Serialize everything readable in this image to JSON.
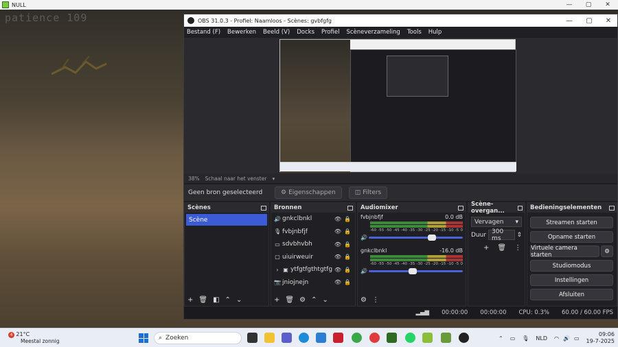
{
  "bg_window": {
    "title": "NULL",
    "patience": "patience 109",
    "controls": {
      "min": "—",
      "max": "▢",
      "close": "✕"
    }
  },
  "obs": {
    "title": "OBS 31.0.3 - Profiel: Naamloos - Scènes: gvbfgfg",
    "controls": {
      "min": "—",
      "max": "▢",
      "close": "✕"
    },
    "menu": [
      "Bestand (F)",
      "Bewerken",
      "Beeld (V)",
      "Docks",
      "Profiel",
      "Scèneverzameling",
      "Tools",
      "Hulp"
    ],
    "zoom": {
      "percent": "38%",
      "label": "Schaal naar het venster"
    },
    "source_bar": {
      "none_selected": "Geen bron geselecteerd",
      "properties": "Eigenschappen",
      "filters": "Filters"
    },
    "scenes": {
      "title": "Scènes",
      "items": [
        "Scène"
      ]
    },
    "sources": {
      "title": "Bronnen",
      "items": [
        {
          "name": "gnkclbnkl",
          "icon": "speaker-icon"
        },
        {
          "name": "fvbjnbfjf",
          "icon": "mic-icon"
        },
        {
          "name": "sdvbhvbh",
          "icon": "monitor-icon"
        },
        {
          "name": "uiuirweuir",
          "icon": "window-icon"
        },
        {
          "name": "ytfgtfgthtgtfg",
          "icon": "folder-icon"
        },
        {
          "name": "jniojnejn",
          "icon": "camera-icon"
        }
      ]
    },
    "mixer": {
      "title": "Audiomixer",
      "channels": [
        {
          "name": "fvbjnbfjf",
          "db": "0.0 dB",
          "level": 0.67
        },
        {
          "name": "gnkclbnkl",
          "db": "-16.0 dB",
          "level": 0.47
        }
      ],
      "ticks": [
        "-60",
        "-55",
        "-50",
        "-45",
        "-40",
        "-35",
        "-30",
        "-25",
        "-20",
        "-15",
        "-10",
        "-5",
        "0"
      ]
    },
    "transitions": {
      "title": "Scène-overgan...",
      "type": "Vervagen",
      "duration_label": "Duur",
      "duration": "300 ms"
    },
    "controls_dock": {
      "title": "Bedieningselementen",
      "buttons": [
        "Streamen starten",
        "Opname starten",
        "Virtuele camera starten",
        "Studiomodus",
        "Instellingen",
        "Afsluiten"
      ]
    },
    "status": {
      "stream_time": "00:00:00",
      "rec_time": "00:00:00",
      "cpu": "CPU: 0.3%",
      "fps": "60.00 / 60.00 FPS"
    }
  },
  "taskbar": {
    "weather_temp": "21°C",
    "weather_desc": "Meestal zonnig",
    "badge": "4",
    "search": "Zoeken",
    "lang": "NLD",
    "time": "09:06",
    "date": "19-7-2025"
  }
}
